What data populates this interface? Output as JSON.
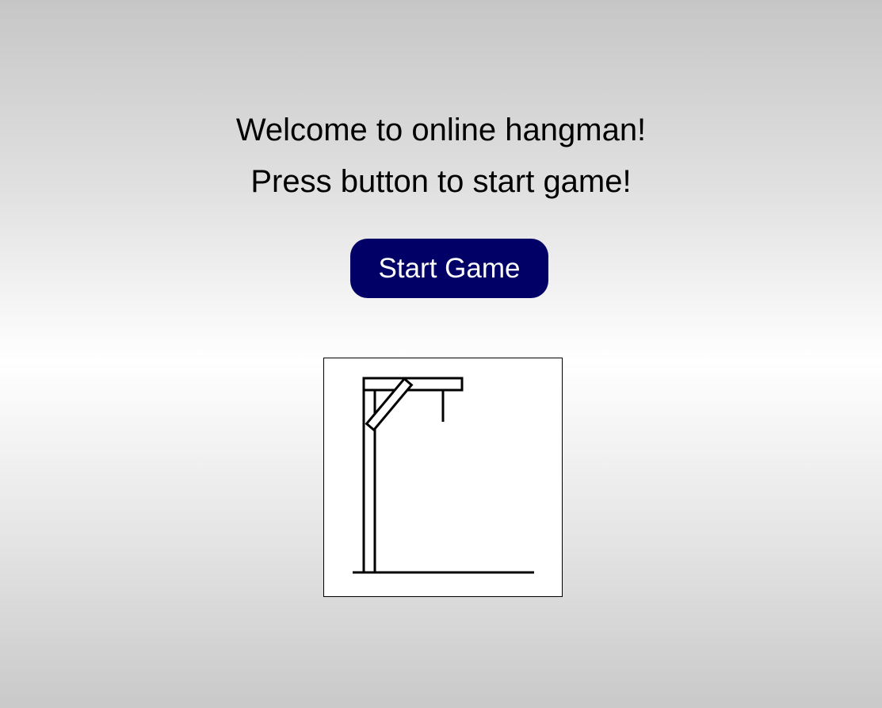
{
  "welcome_text": "Welcome to online hangman!",
  "instruction_text": "Press button to start game!",
  "start_button_label": "Start Game",
  "colors": {
    "button_background": "#000066",
    "button_text": "#ffffff",
    "canvas_background": "#ffffff",
    "drawing_stroke": "#000000"
  },
  "hangman": {
    "stage": "gallows-only",
    "parts_shown": [
      "base",
      "pole",
      "beam",
      "brace",
      "rope"
    ]
  }
}
